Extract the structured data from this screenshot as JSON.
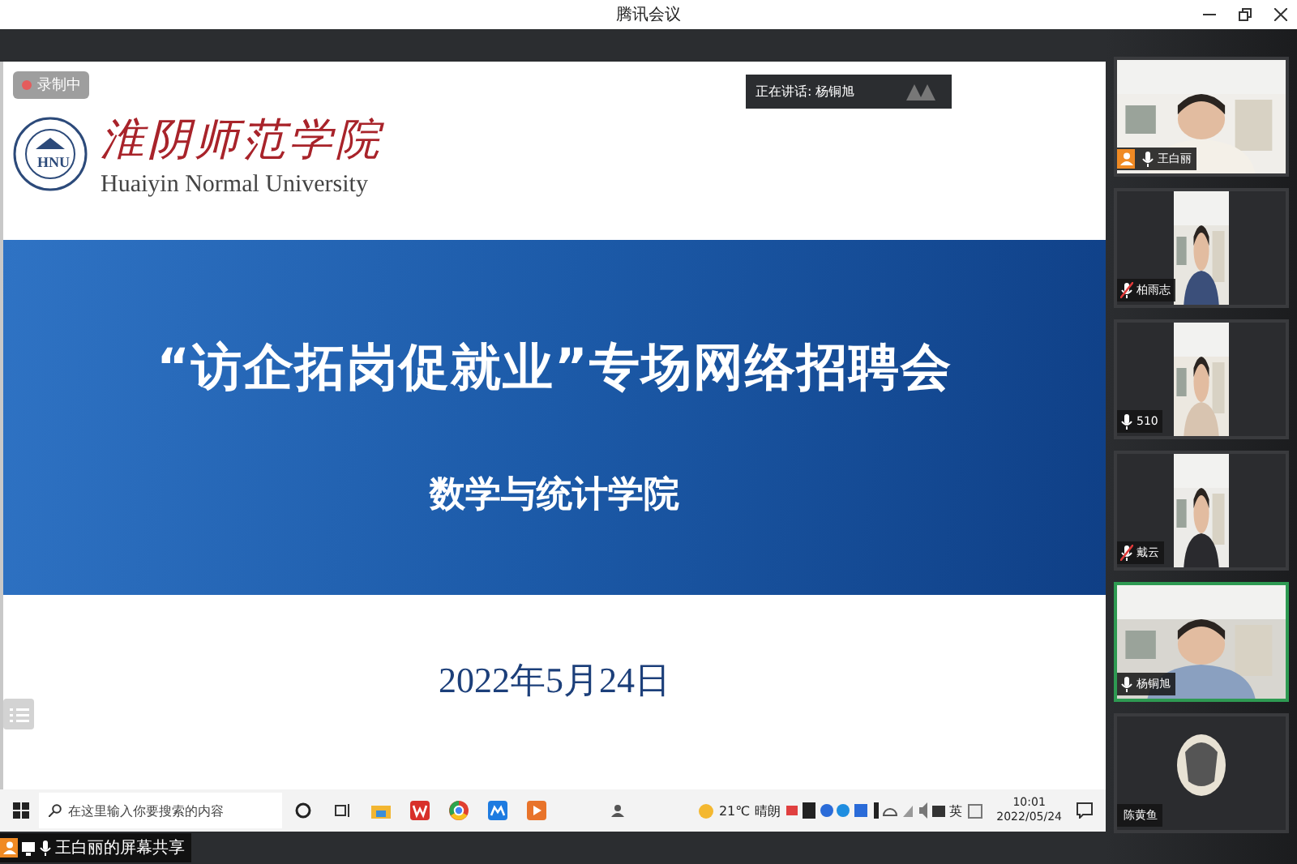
{
  "window": {
    "title": "腾讯会议"
  },
  "recording": {
    "label": "录制中"
  },
  "speaking": {
    "label": "正在讲话: 杨铜旭"
  },
  "slide": {
    "school_name_cn": "淮阴师范学院",
    "school_name_en": "Huaiyin Normal University",
    "logo_text": "HNU",
    "title": "“访企拓岗促就业”专场网络招聘会",
    "subtitle": "数学与统计学院",
    "date": "2022年5月24日"
  },
  "taskbar": {
    "search_placeholder": "在这里输入你要搜索的内容",
    "weather": "21℃",
    "weather_text": "晴朗",
    "language": "英",
    "time": "10:01",
    "date": "2022/05/24"
  },
  "share_bar": {
    "label": "王白丽的屏幕共享"
  },
  "participants": [
    {
      "name": "王白丽",
      "kind": "video",
      "host": true,
      "muted": false,
      "speaking": false
    },
    {
      "name": "柏雨志",
      "kind": "portrait_video",
      "host": false,
      "muted": true,
      "speaking": false
    },
    {
      "name": "510",
      "kind": "portrait_video",
      "host": false,
      "muted": false,
      "speaking": false
    },
    {
      "name": "戴云",
      "kind": "portrait_video",
      "host": false,
      "muted": true,
      "speaking": false
    },
    {
      "name": "杨铜旭",
      "kind": "video",
      "host": false,
      "muted": false,
      "speaking": true
    },
    {
      "name": "陈黄鱼",
      "kind": "avatar",
      "host": false,
      "speaking": false
    }
  ]
}
